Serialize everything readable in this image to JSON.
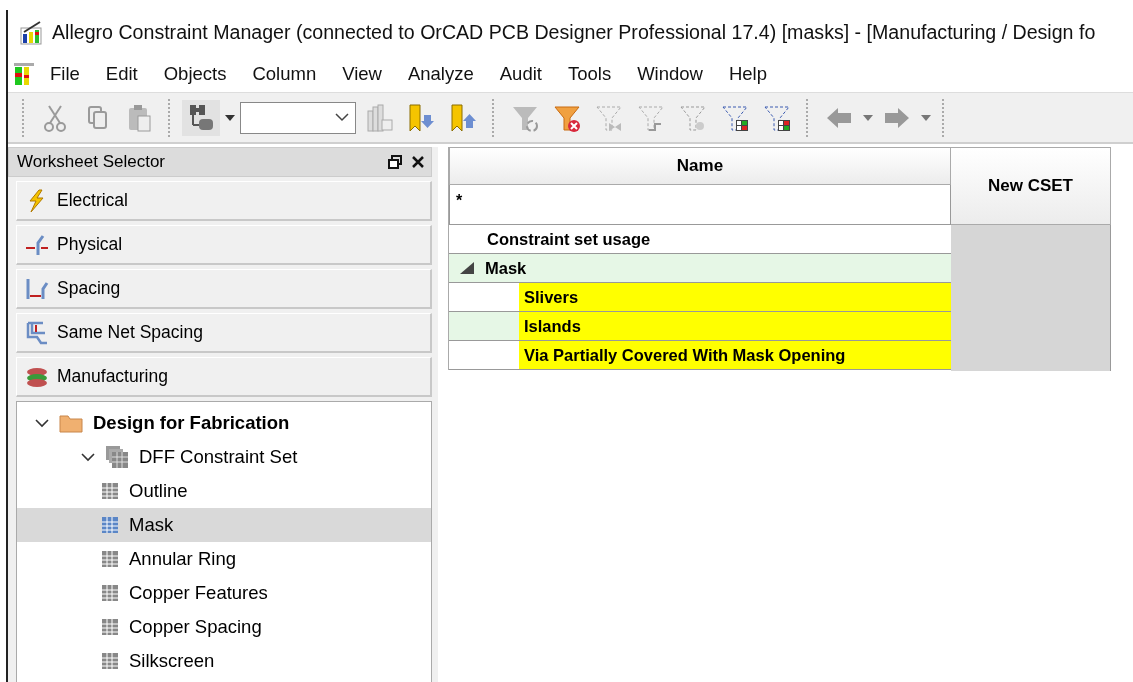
{
  "window": {
    "title": "Allegro Constraint Manager (connected to OrCAD PCB Designer Professional 17.4) [masks] - [Manufacturing / Design fo"
  },
  "menu": [
    "File",
    "Edit",
    "Objects",
    "Column",
    "View",
    "Analyze",
    "Audit",
    "Tools",
    "Window",
    "Help"
  ],
  "worksheet_selector": {
    "title": "Worksheet Selector",
    "categories": [
      "Electrical",
      "Physical",
      "Spacing",
      "Same Net Spacing",
      "Manufacturing"
    ],
    "tree": [
      {
        "label": "Design for Fabrication",
        "expanded": true,
        "children": [
          {
            "label": "DFF Constraint Set",
            "expanded": true,
            "children": [
              {
                "label": "Outline",
                "selected": false
              },
              {
                "label": "Mask",
                "selected": true
              },
              {
                "label": "Annular Ring",
                "selected": false
              },
              {
                "label": "Copper Features",
                "selected": false
              },
              {
                "label": "Copper Spacing",
                "selected": false
              },
              {
                "label": "Silkscreen",
                "selected": false
              }
            ]
          }
        ]
      }
    ]
  },
  "grid": {
    "columns": [
      "Name",
      "New CSET"
    ],
    "filter": "*",
    "rows": [
      {
        "kind": "header",
        "label": "Constraint set usage"
      },
      {
        "kind": "group",
        "label": "Mask",
        "expanded": true
      },
      {
        "kind": "item",
        "label": "Slivers",
        "highlighted": true
      },
      {
        "kind": "item",
        "label": "Islands",
        "highlighted": true
      },
      {
        "kind": "item",
        "label": "Via Partially Covered With Mask Opening",
        "highlighted": true
      }
    ]
  }
}
